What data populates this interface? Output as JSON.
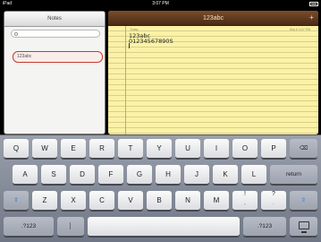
{
  "status_bar": {
    "carrier": "iPad",
    "time": "3:07 PM"
  },
  "notes_list": {
    "title": "Notes",
    "search_placeholder": "",
    "items": [
      {
        "label": "123abc"
      }
    ]
  },
  "note": {
    "title": "123abc",
    "date": "Today",
    "time": "Sep 6  3:07 PM",
    "line1": "123abc",
    "line2": "01234567890S",
    "add_label": "+"
  },
  "keyboard": {
    "row1": [
      "Q",
      "W",
      "E",
      "R",
      "T",
      "Y",
      "U",
      "I",
      "O",
      "P"
    ],
    "row2": [
      "A",
      "S",
      "D",
      "F",
      "G",
      "H",
      "J",
      "K",
      "L"
    ],
    "return_label": "return",
    "row3": [
      "Z",
      "X",
      "C",
      "V",
      "B",
      "N",
      "M"
    ],
    "exclaim_main": "!",
    "exclaim_sub": ",",
    "question_main": "?",
    "question_sub": ".",
    "numbers_label": ".?123",
    "mic_label": "│",
    "delete_glyph": "⌫",
    "shift_glyph": "⇧"
  },
  "colors": {
    "accent_red": "#c53a2e",
    "paper_yellow": "#fbf2a6",
    "leather_brown": "#5f3a1f"
  }
}
